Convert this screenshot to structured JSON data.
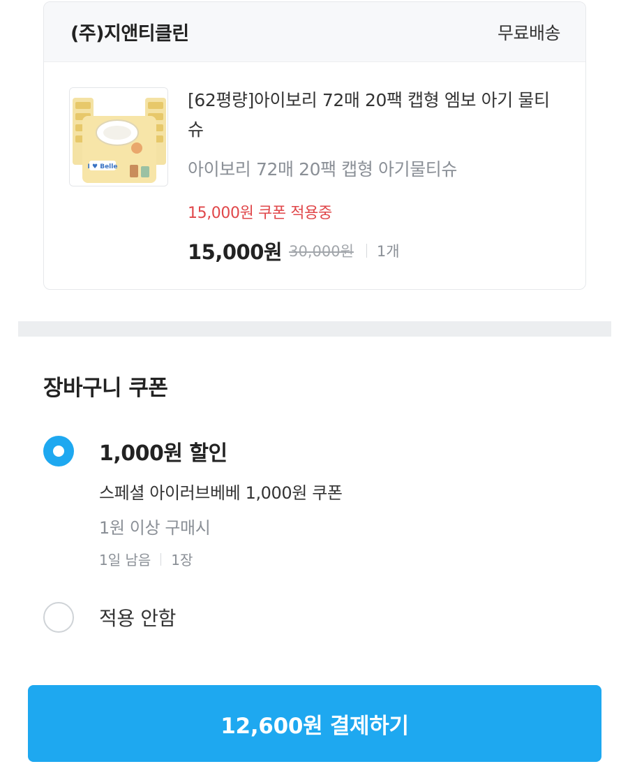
{
  "seller": {
    "name": "(주)지앤티클린",
    "shipping": "무료배송"
  },
  "product": {
    "title": "[62평량]아이보리 72매 20팩 캡형 엠보 아기 물티슈",
    "option": "아이보리 72매 20팩 캡형 아기물티슈",
    "coupon_status": "15,000원 쿠폰 적용중",
    "price": "15,000원",
    "original_price": "30,000원",
    "quantity": "1개",
    "thumbnail_brand": "I ♥ Belle"
  },
  "coupon_section": {
    "title": "장바구니 쿠폰",
    "options": [
      {
        "selected": true,
        "title": "1,000원 할인",
        "name": "스페셜 아이러브베베 1,000원 쿠폰",
        "condition": "1원 이상 구매시",
        "remaining": "1일 남음",
        "count": "1장"
      },
      {
        "selected": false,
        "title": "적용 안함"
      }
    ]
  },
  "pay_button": {
    "label": "12,600원 결제하기"
  },
  "colors": {
    "accent": "#1ea8f0",
    "coupon_text": "#e0474a"
  }
}
